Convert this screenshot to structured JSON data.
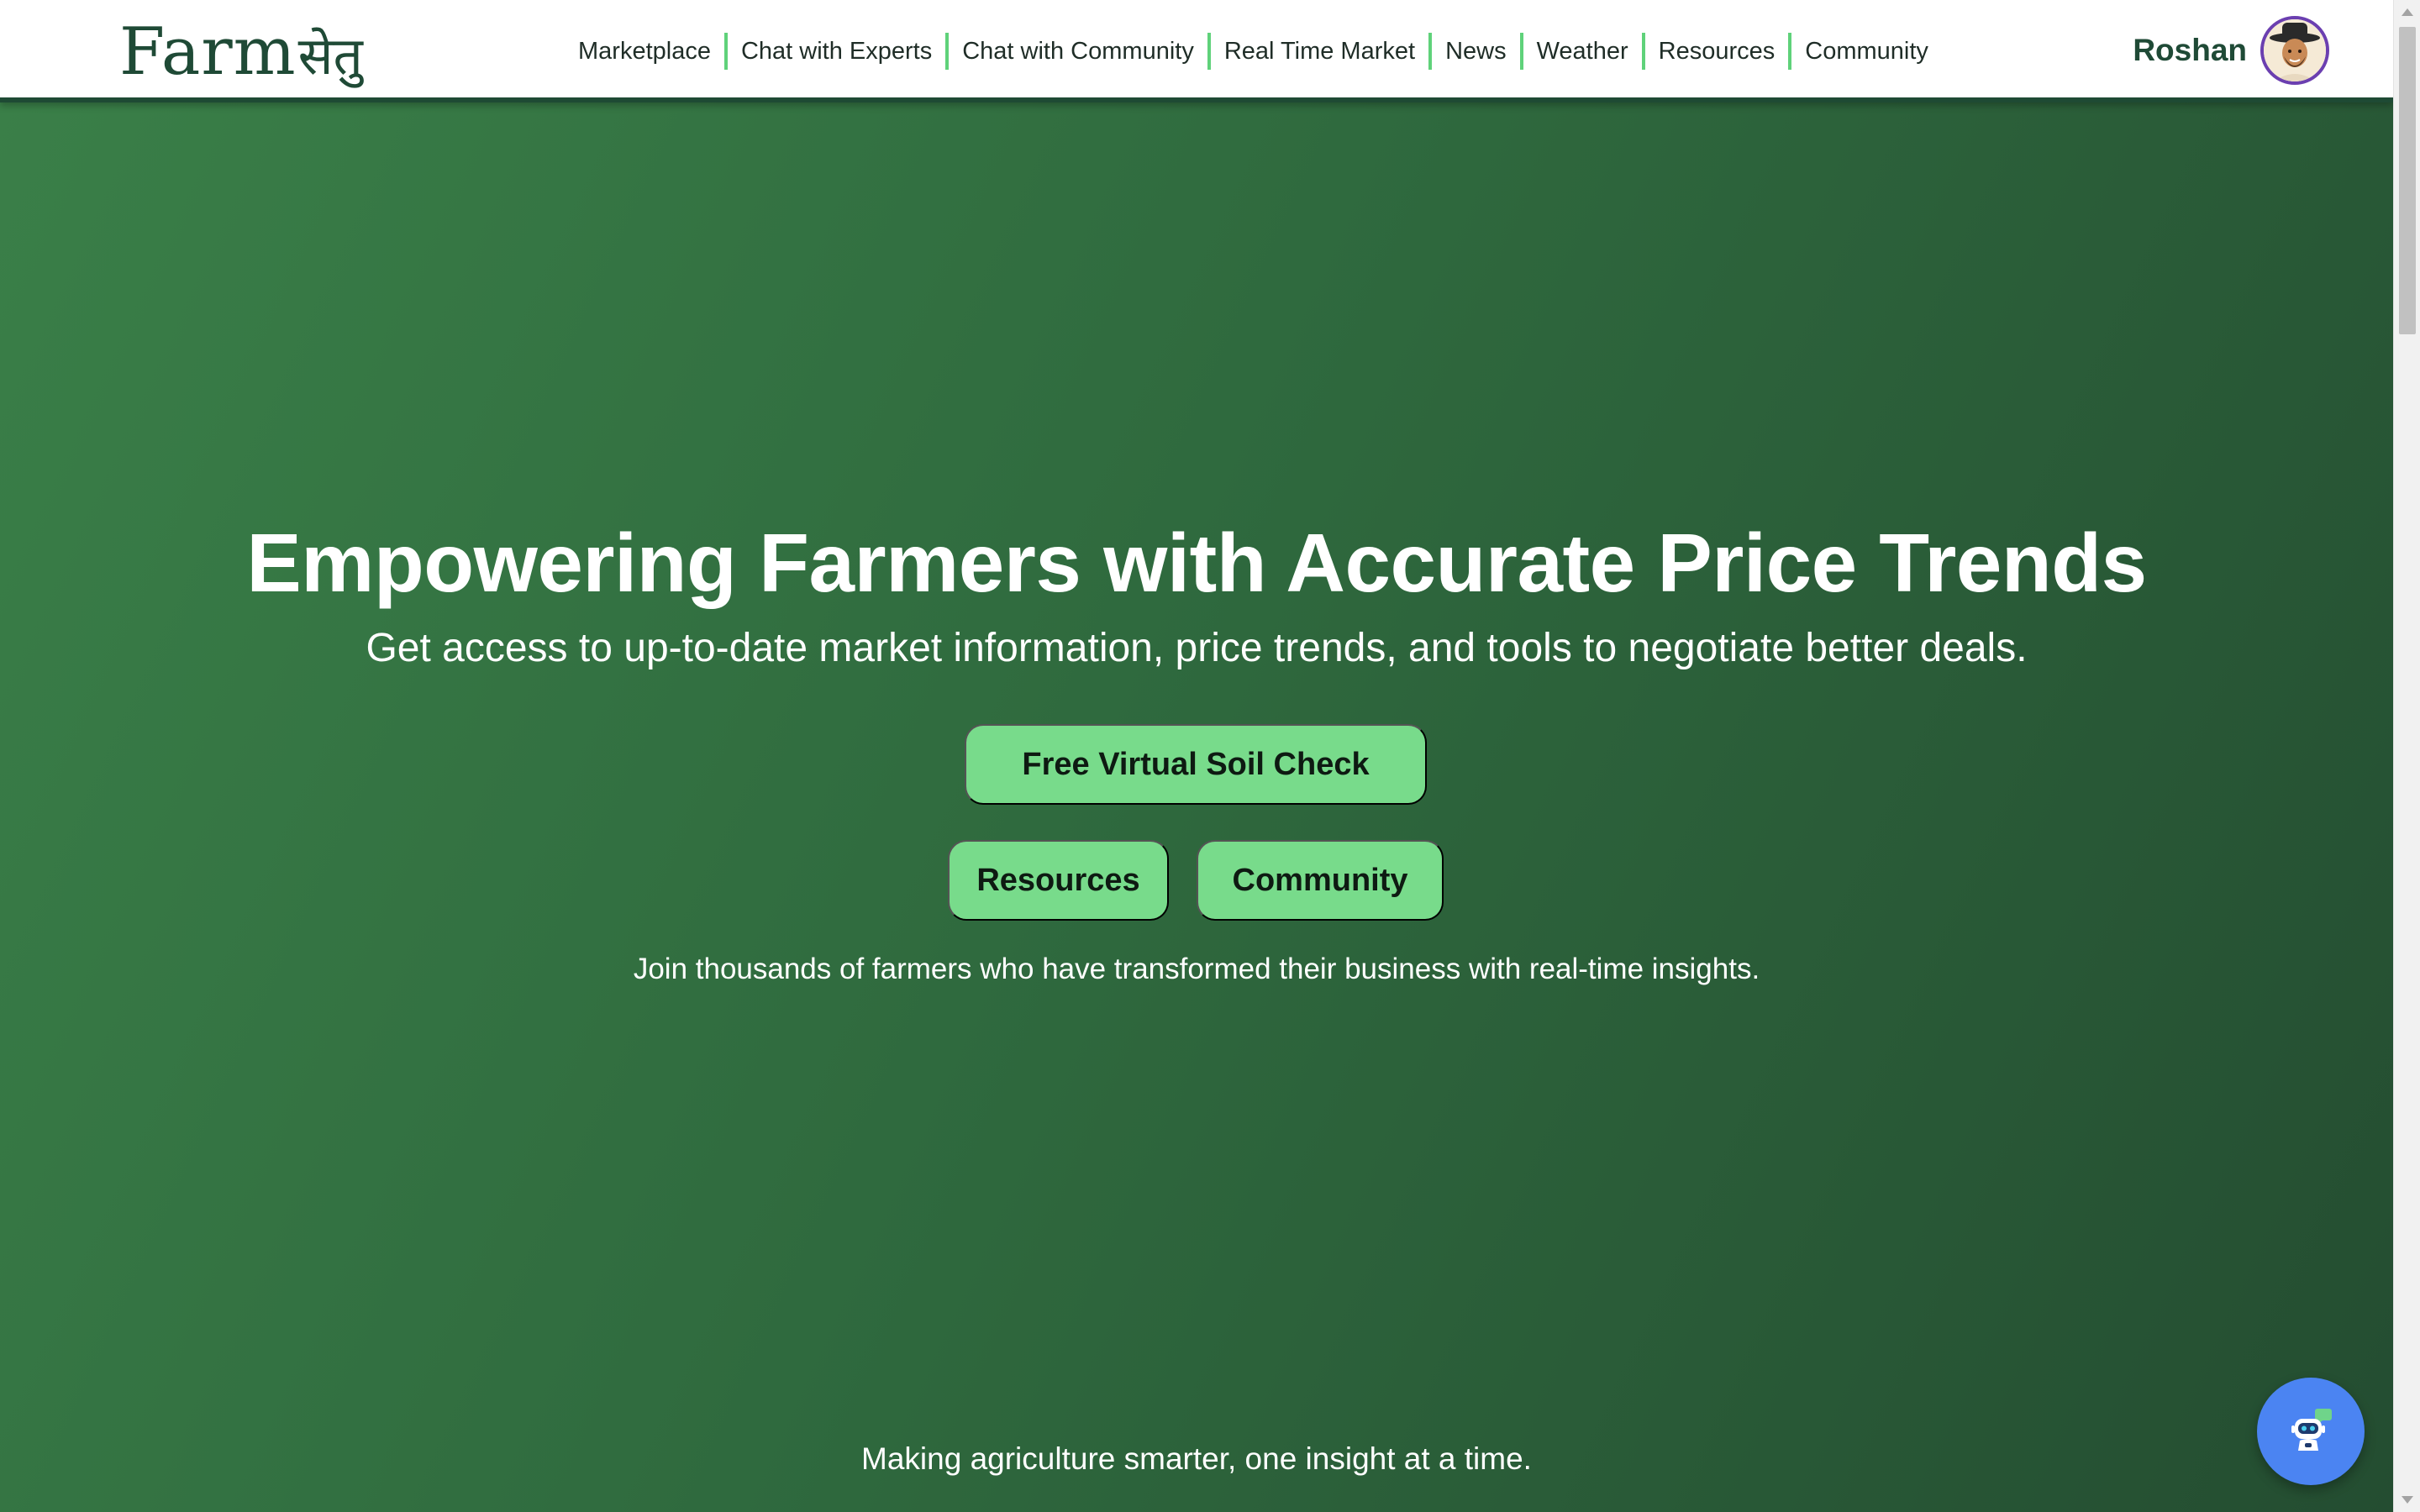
{
  "brand": {
    "logo_latin": "Farm",
    "logo_devanagari": "सेतु",
    "color": "#1f4a36"
  },
  "nav": {
    "items": [
      {
        "label": "Marketplace"
      },
      {
        "label": "Chat with Experts"
      },
      {
        "label": "Chat with Community"
      },
      {
        "label": "Real Time Market"
      },
      {
        "label": "News"
      },
      {
        "label": "Weather"
      },
      {
        "label": "Resources"
      },
      {
        "label": "Community"
      }
    ],
    "separator_color": "#5fd27a"
  },
  "user": {
    "name": "Roshan",
    "avatar_icon": "user-avatar-icon"
  },
  "hero": {
    "title": "Empowering Farmers with Accurate Price Trends",
    "subtitle": "Get access to up-to-date market information, price trends, and tools to negotiate better deals.",
    "primary_button": "Free Virtual Soil Check",
    "secondary_buttons": {
      "resources": "Resources",
      "community": "Community"
    },
    "join_text": "Join thousands of farmers who have transformed their business with real-time insights.",
    "tagline": "Making agriculture smarter, one insight at a time.",
    "gradient_colors": [
      "#3a7f48",
      "#244d31"
    ],
    "button_color": "#78db8b"
  },
  "chatbot": {
    "icon": "chatbot-icon",
    "color": "#4b84f2"
  }
}
